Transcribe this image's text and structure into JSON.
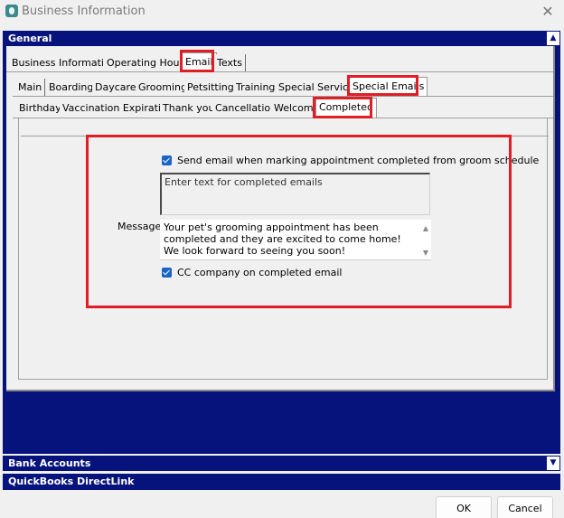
{
  "window": {
    "title": "Business Information",
    "close_label": "✕"
  },
  "sections": {
    "general": "General",
    "bank": "Bank Accounts",
    "quickbooks": "QuickBooks DirectLink",
    "expanded_glyph": "▲",
    "collapsed_glyph": "▼"
  },
  "tabs_top": [
    "Business Information",
    "Operating Hours",
    "Email",
    "Texts"
  ],
  "tabs_email": [
    "Main",
    "Boarding",
    "Daycare",
    "Grooming",
    "Petsitting",
    "Training",
    "Special Services",
    "Special Emails"
  ],
  "tabs_special": [
    "Birthday",
    "Vaccination Expiration",
    "Thank you",
    "Cancellation",
    "Welcome",
    "Completed"
  ],
  "completed": {
    "send_email_label": "Send email when marking appointment completed from groom schedule",
    "placeholder_text": "Enter text for completed emails",
    "message_label": "Message:",
    "message_text": "Your pet's grooming appointment has been completed and they are excited to come home! We look forward to seeing you soon!",
    "cc_label": "CC company on completed email"
  },
  "buttons": {
    "ok": "OK",
    "cancel": "Cancel"
  },
  "colors": {
    "section_bar": "#06137c",
    "highlight": "#e01e25",
    "checkbox": "#1a64c8"
  }
}
